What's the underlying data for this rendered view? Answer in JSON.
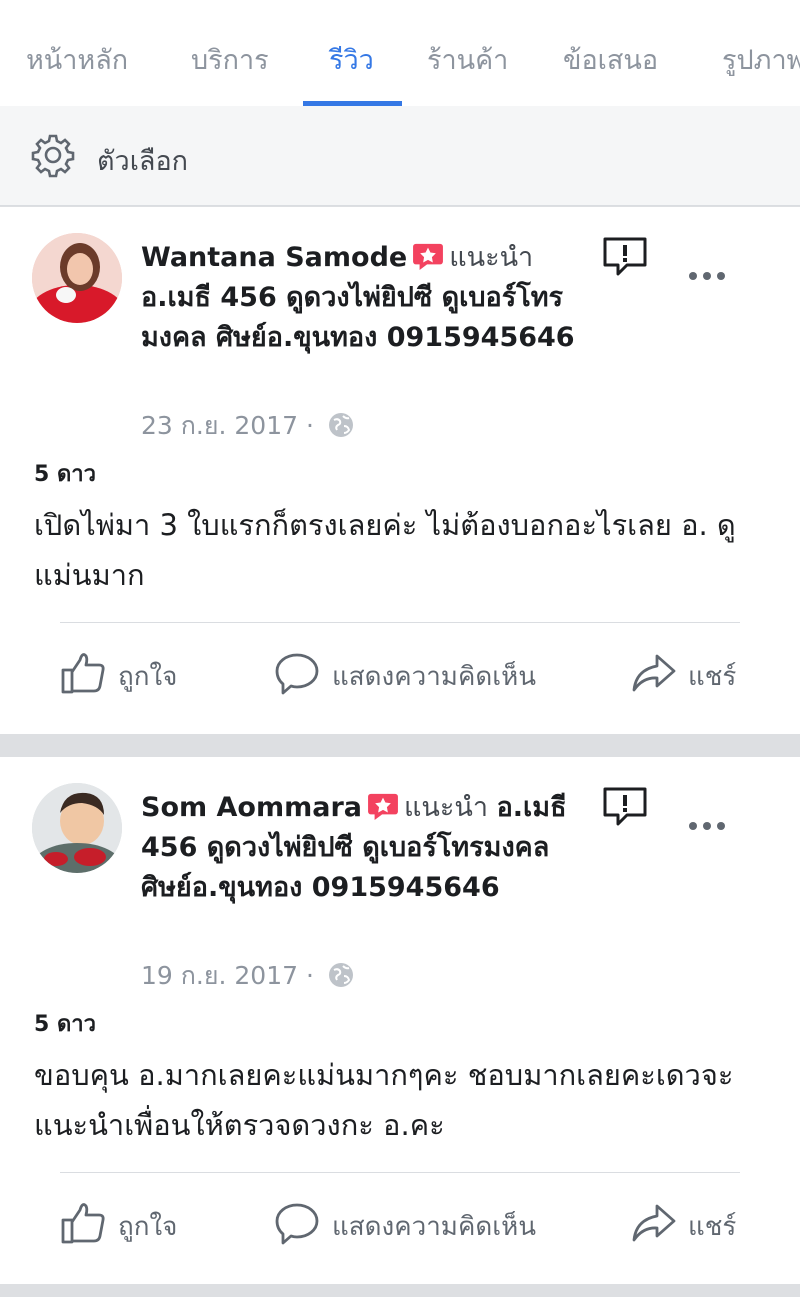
{
  "tabs": [
    "หน้าหลัก",
    "บริการ",
    "รีวิว",
    "ร้านค้า",
    "ข้อเสนอ",
    "รูปภาพ"
  ],
  "active_tab": "รีวิว",
  "options_label": "ตัวเลือก",
  "reviews": [
    {
      "name": "Wantana Samode",
      "recommends": "แนะนำ",
      "page": "อ.เมธี 456 ดูดวงไพ่ยิปซี ดูเบอร์โทรมงคล ศิษย์อ.ขุนทอง 0915945646",
      "date": "23 ก.ย. 2017",
      "dot": "·",
      "rating": "5 ดาว",
      "text": "เปิดไพ่มา 3 ใบแรกก็ตรงเลยค่ะ ไม่ต้องบอกอะไรเลย อ. ดูแม่นมาก"
    },
    {
      "name": "Som Aommara",
      "recommends": "แนะนำ",
      "page": "อ.เมธี 456 ดูดวงไพ่ยิปซี ดูเบอร์โทรมงคล ศิษย์อ.ขุนทอง 0915945646",
      "date": "19 ก.ย. 2017",
      "dot": "·",
      "rating": "5 ดาว",
      "text": "ขอบคุน อ.มากเลยคะแม่นมากๆคะ ชอบมากเลยคะเดวจะแนะนำเพื่อนให้ตรวจดวงกะ อ.คะ"
    }
  ],
  "actions": {
    "like": "ถูกใจ",
    "comment": "แสดงความคิดเห็น",
    "share": "แชร์"
  },
  "colors": {
    "accent": "#3578e5",
    "badge": "#f3425f",
    "muted": "#8d949e"
  }
}
